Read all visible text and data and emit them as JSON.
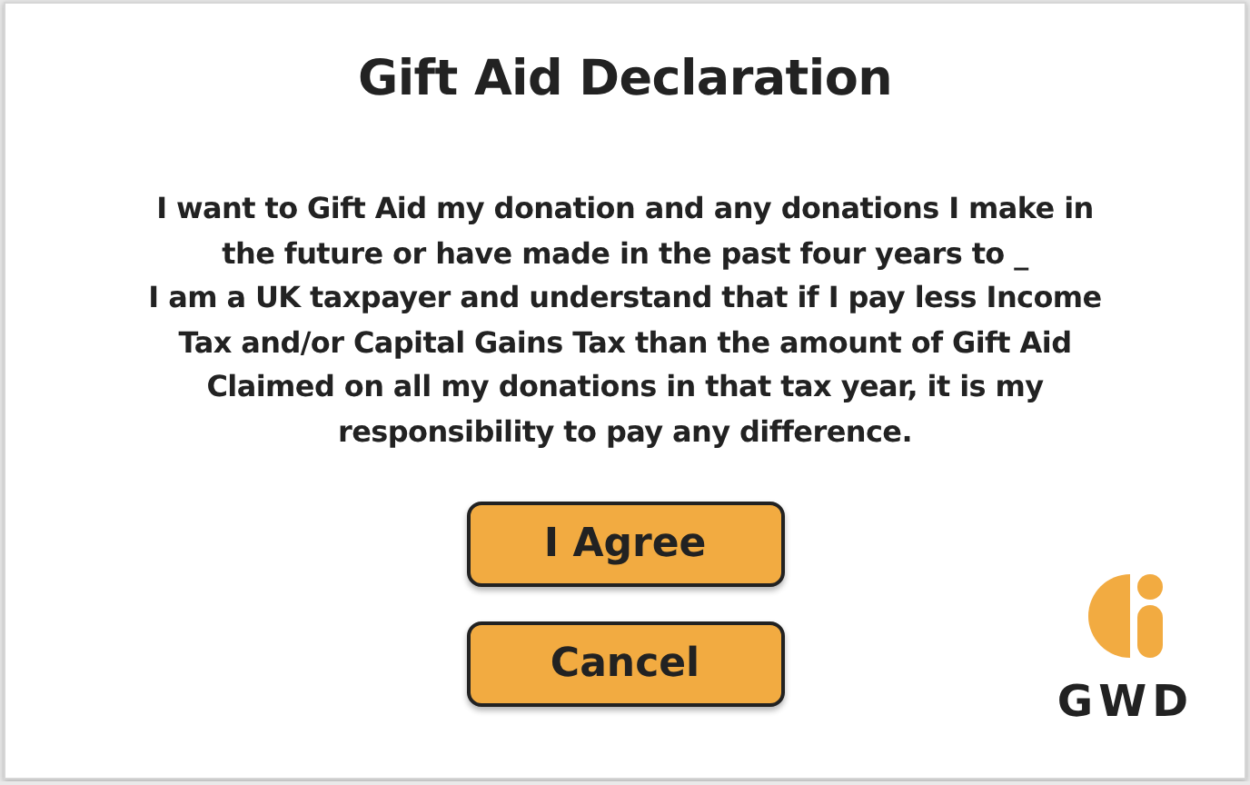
{
  "title": "Gift Aid Declaration",
  "declaration_lines": [
    "I want to Gift Aid my donation and any donations I make in",
    "the future or have made in the past four years to _",
    "I am a UK taxpayer and understand that if I pay less Income",
    "Tax and/or Capital Gains Tax than the amount of Gift Aid",
    "Claimed on all my donations in that tax year, it is my",
    "responsibility to pay any difference."
  ],
  "buttons": [
    "I Agree",
    "Cancel"
  ],
  "logo": {
    "text": "GWD"
  }
}
